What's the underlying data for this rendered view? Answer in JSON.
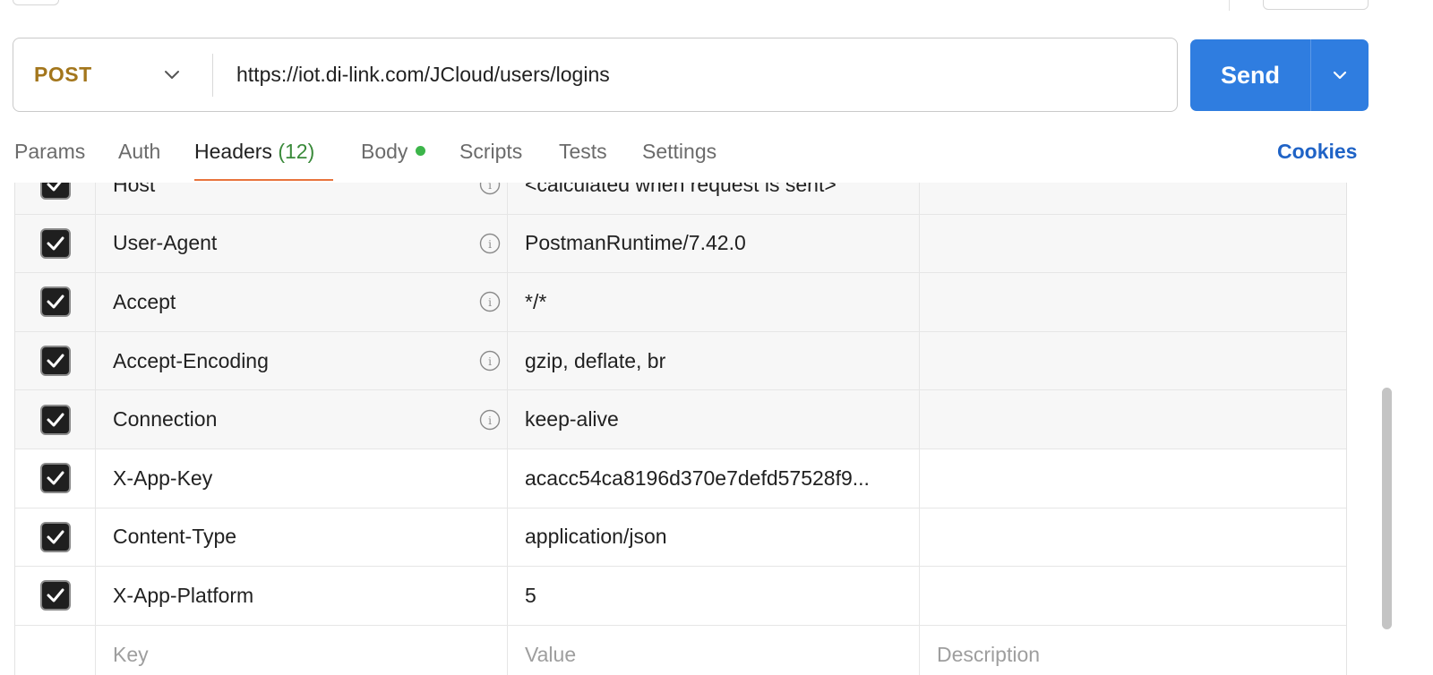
{
  "request": {
    "method": "POST",
    "url": "https://iot.di-link.com/JCloud/users/logins"
  },
  "send": {
    "label": "Send"
  },
  "tabs": {
    "params": "Params",
    "auth": "Auth",
    "headers": "Headers",
    "headers_count": "(12)",
    "body": "Body",
    "scripts": "Scripts",
    "tests": "Tests",
    "settings": "Settings",
    "cookies": "Cookies"
  },
  "headers": [
    {
      "key": "Host",
      "value": "<calculated when request is sent>",
      "auto": true
    },
    {
      "key": "User-Agent",
      "value": "PostmanRuntime/7.42.0",
      "auto": true
    },
    {
      "key": "Accept",
      "value": "*/*",
      "auto": true
    },
    {
      "key": "Accept-Encoding",
      "value": "gzip, deflate, br",
      "auto": true
    },
    {
      "key": "Connection",
      "value": "keep-alive",
      "auto": true
    },
    {
      "key": "X-App-Key",
      "value": "acacc54ca8196d370e7defd57528f9...",
      "auto": false
    },
    {
      "key": "Content-Type",
      "value": "application/json",
      "auto": false
    },
    {
      "key": "X-App-Platform",
      "value": "5",
      "auto": false
    }
  ],
  "new_row": {
    "key_placeholder": "Key",
    "value_placeholder": "Value",
    "description_placeholder": "Description"
  },
  "colors": {
    "method": "#a3761c",
    "send": "#2f7de0",
    "active_tab_underline": "#e8743c",
    "headers_count": "#3a8a3a",
    "body_dot": "#3cb54a",
    "cookies": "#1f63c6"
  }
}
